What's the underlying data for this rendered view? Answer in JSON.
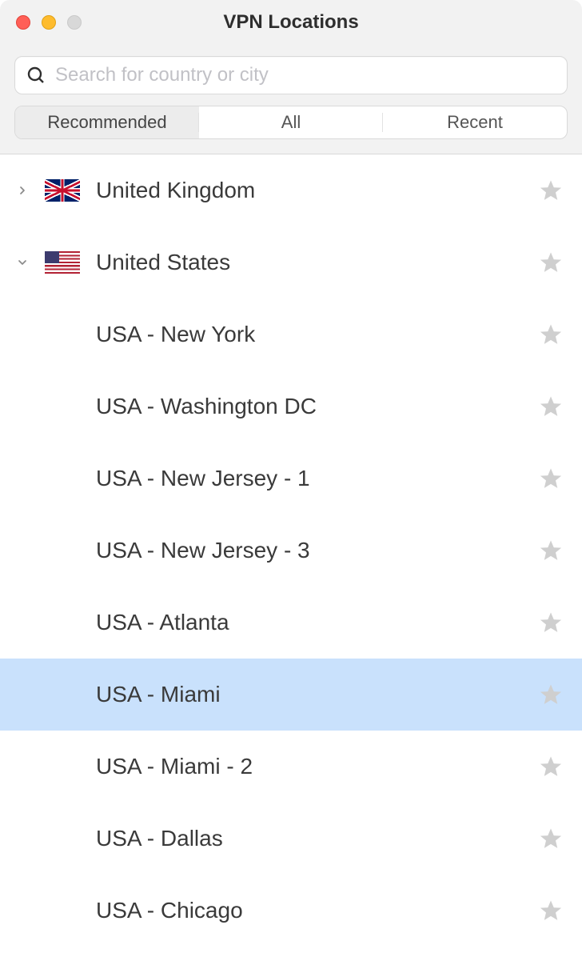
{
  "window": {
    "title": "VPN Locations"
  },
  "search": {
    "placeholder": "Search for country or city",
    "value": ""
  },
  "tabs": {
    "items": [
      {
        "label": "Recommended",
        "active": true
      },
      {
        "label": "All",
        "active": false
      },
      {
        "label": "Recent",
        "active": false
      }
    ]
  },
  "locations": [
    {
      "type": "country",
      "label": "United Kingdom",
      "flag": "uk",
      "expanded": false,
      "favorite": false,
      "selected": false
    },
    {
      "type": "country",
      "label": "United States",
      "flag": "us",
      "expanded": true,
      "favorite": false,
      "selected": false
    },
    {
      "type": "city",
      "label": "USA - New York",
      "favorite": false,
      "selected": false
    },
    {
      "type": "city",
      "label": "USA - Washington DC",
      "favorite": false,
      "selected": false
    },
    {
      "type": "city",
      "label": "USA - New Jersey - 1",
      "favorite": false,
      "selected": false
    },
    {
      "type": "city",
      "label": "USA - New Jersey - 3",
      "favorite": false,
      "selected": false
    },
    {
      "type": "city",
      "label": "USA - Atlanta",
      "favorite": false,
      "selected": false
    },
    {
      "type": "city",
      "label": "USA - Miami",
      "favorite": false,
      "selected": true
    },
    {
      "type": "city",
      "label": "USA - Miami - 2",
      "favorite": false,
      "selected": false
    },
    {
      "type": "city",
      "label": "USA - Dallas",
      "favorite": false,
      "selected": false
    },
    {
      "type": "city",
      "label": "USA - Chicago",
      "favorite": false,
      "selected": false
    }
  ]
}
